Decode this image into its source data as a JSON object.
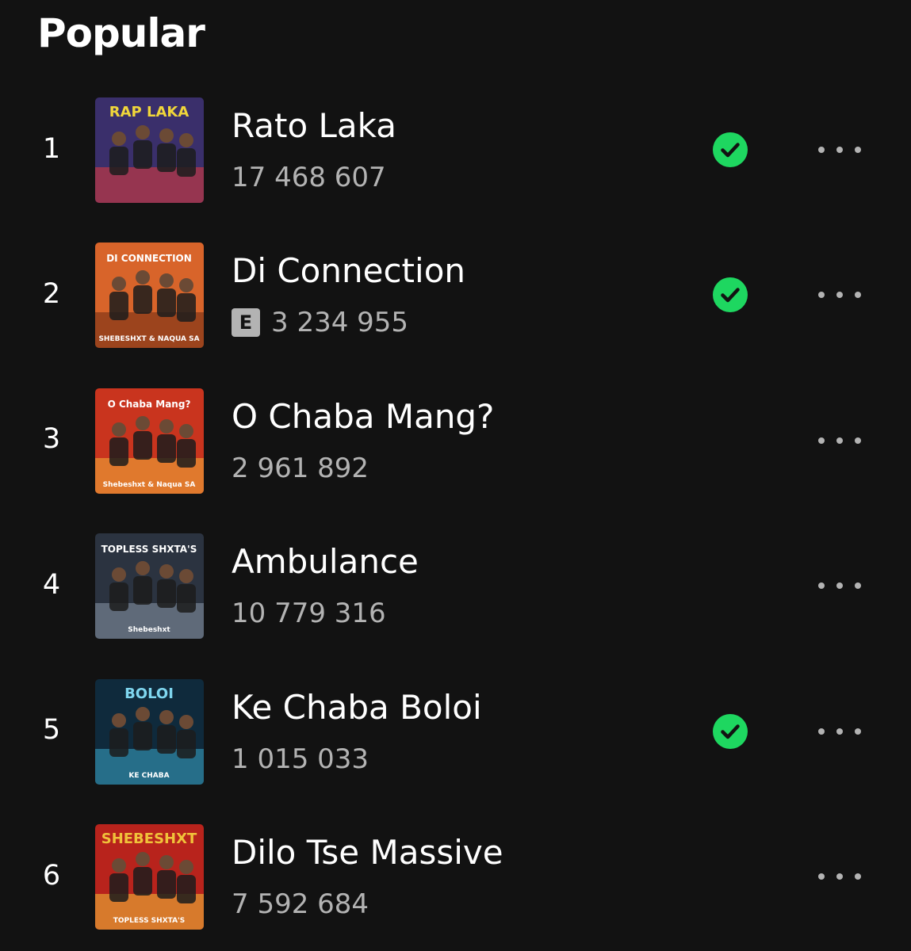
{
  "section": {
    "title": "Popular"
  },
  "tracks": [
    {
      "rank": "1",
      "title": "Rato Laka",
      "plays": "17 468 607",
      "explicit": false,
      "saved": true,
      "cover": {
        "bg": "#3a2f6b",
        "accent": "#e23a3a",
        "text": "RAP LAKA",
        "text_color": "#f0d63a"
      }
    },
    {
      "rank": "2",
      "title": "Di Connection",
      "plays": "3 234 955",
      "explicit": true,
      "explicit_label": "E",
      "saved": true,
      "cover": {
        "bg": "#d8642a",
        "accent": "#6b2a12",
        "text": "DI CONNECTION",
        "text_color": "#ffffff",
        "footer": "SHEBESHXT & NAQUA SA"
      }
    },
    {
      "rank": "3",
      "title": "O Chaba Mang?",
      "plays": "2 961 892",
      "explicit": false,
      "saved": false,
      "cover": {
        "bg": "#c9341e",
        "accent": "#f2b23a",
        "text": "O Chaba Mang?",
        "text_color": "#ffffff",
        "footer": "Shebeshxt & Naqua SA"
      }
    },
    {
      "rank": "4",
      "title": "Ambulance",
      "plays": "10 779 316",
      "explicit": false,
      "saved": false,
      "cover": {
        "bg": "#2b3340",
        "accent": "#8a97a8",
        "text": "TOPLESS SHXTA'S",
        "text_color": "#ffffff",
        "footer": "Shebeshxt"
      }
    },
    {
      "rank": "5",
      "title": "Ke Chaba Boloi",
      "plays": "1 015 033",
      "explicit": false,
      "saved": true,
      "cover": {
        "bg": "#0f2a3c",
        "accent": "#3aa6c8",
        "text": "BOLOI",
        "text_color": "#7fd6ef",
        "footer": "KE CHABA"
      }
    },
    {
      "rank": "6",
      "title": "Dilo Tse Massive",
      "plays": "7 592 684",
      "explicit": false,
      "saved": false,
      "cover": {
        "bg": "#b8231c",
        "accent": "#f0c23a",
        "text": "SHEBESHXT",
        "text_color": "#f0c23a",
        "footer": "TOPLESS SHXTA'S"
      }
    }
  ],
  "icons": {
    "saved": "check-circle-icon",
    "more": "more-horizontal-icon"
  },
  "colors": {
    "background": "#121212",
    "accent": "#1ed760",
    "secondary_text": "#b3b3b3"
  }
}
